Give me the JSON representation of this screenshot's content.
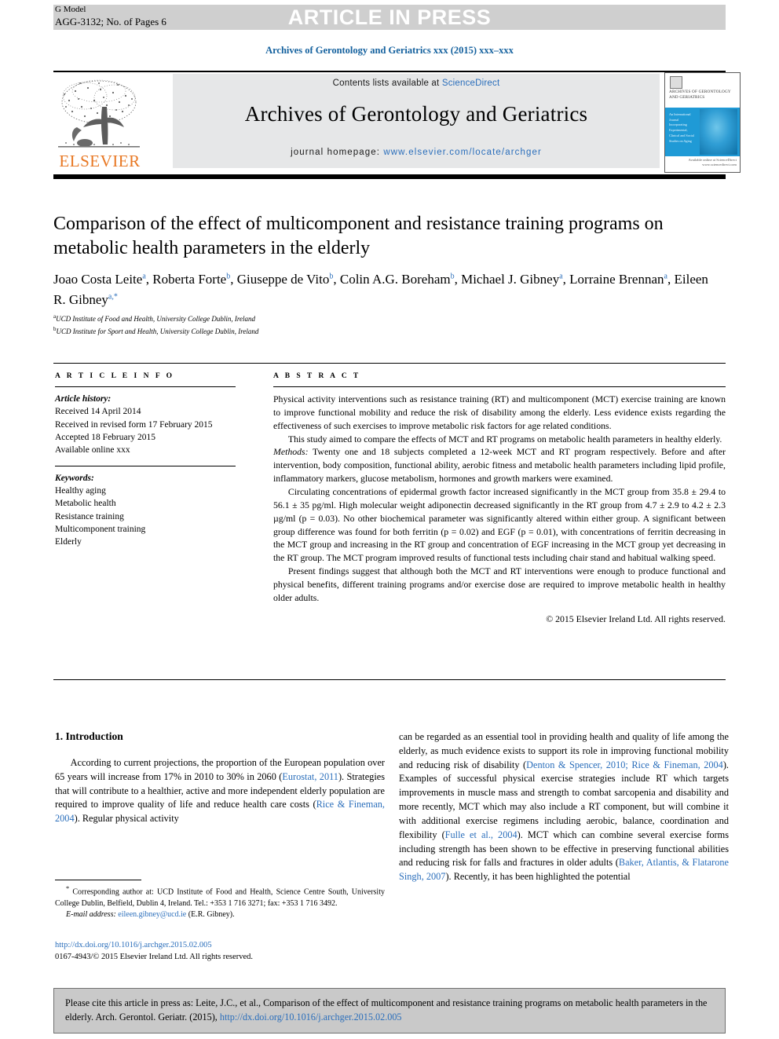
{
  "banner": {
    "gmodel_line1": "G Model",
    "gmodel_line2": "AGG-3132; No. of Pages 6",
    "article_in_press": "ARTICLE IN PRESS"
  },
  "running_head": "Archives of Gerontology and Geriatrics xxx (2015) xxx–xxx",
  "masthead": {
    "contents_prefix": "Contents lists available at ",
    "sciencedirect": "ScienceDirect",
    "journal_title": "Archives of Gerontology and Geriatrics",
    "homepage_prefix": "journal homepage: ",
    "homepage_url": "www.elsevier.com/locate/archger",
    "publisher": "ELSEVIER",
    "cover_title": "ARCHIVES OF GERONTOLOGY AND GERIATRICS",
    "cover_sub": "An International Journal Incorporating Experimental, Clinical and Social Studies on Aging",
    "cover_footer": "Available online at ScienceDirect www.sciencedirect.com"
  },
  "article": {
    "title": "Comparison of the effect of multicomponent and resistance training programs on metabolic health parameters in the elderly",
    "authors_line1": "Joao Costa Leite",
    "authors_line1_sup": "a",
    "authors_html": "Joao Costa Leite<sup>a</sup>, Roberta Forte<sup>b</sup>, Giuseppe de Vito<sup>b</sup>, Colin A.G. Boreham<sup>b</sup>, Michael J. Gibney<sup>a</sup>, Lorraine Brennan<sup>a</sup>, Eileen R. Gibney<sup>a,*</sup>",
    "affiliation_a": "UCD Institute of Food and Health, University College Dublin, Ireland",
    "affiliation_b": "UCD Institute for Sport and Health, University College Dublin, Ireland"
  },
  "article_info": {
    "heading": "A R T I C L E  I N F O",
    "history_label": "Article history:",
    "history": [
      "Received 14 April 2014",
      "Received in revised form 17 February 2015",
      "Accepted 18 February 2015",
      "Available online xxx"
    ],
    "keywords_label": "Keywords:",
    "keywords": [
      "Healthy aging",
      "Metabolic health",
      "Resistance training",
      "Multicomponent training",
      "Elderly"
    ]
  },
  "abstract": {
    "heading": "A B S T R A C T",
    "p1": "Physical activity interventions such as resistance training (RT) and multicomponent (MCT) exercise training are known to improve functional mobility and reduce the risk of disability among the elderly. Less evidence exists regarding the effectiveness of such exercises to improve metabolic risk factors for age related conditions.",
    "p2": "This study aimed to compare the effects of MCT and RT programs on metabolic health parameters in healthy elderly.",
    "p3_label": "Methods:",
    "p3": " Twenty one and 18 subjects completed a 12-week MCT and RT program respectively. Before and after intervention, body composition, functional ability, aerobic fitness and metabolic health parameters including lipid profile, inflammatory markers, glucose metabolism, hormones and growth markers were examined.",
    "p4": "Circulating concentrations of epidermal growth factor increased significantly in the MCT group from 35.8 ± 29.4  to 56.1 ± 35 pg/ml. High molecular weight adiponectin decreased significantly in the RT group from  4.7 ± 2.9  to 4.2 ± 2.3 µg/ml (p = 0.03). No other biochemical parameter was significantly altered within either group. A significant between group difference was found for both ferritin (p = 0.02) and EGF (p = 0.01), with concentrations of ferritin decreasing in the MCT group and increasing in the RT group and concentration of EGF increasing in the MCT group yet decreasing in the RT group. The MCT program improved results of functional tests including chair stand and habitual walking speed.",
    "p5": "Present findings suggest that although both the MCT and RT interventions were enough to produce functional and physical benefits, different training programs and/or exercise dose are required to improve metabolic health in healthy older adults.",
    "copyright": "© 2015 Elsevier Ireland Ltd. All rights reserved."
  },
  "introduction": {
    "heading": "1. Introduction",
    "left_p1_a": "According to current projections, the proportion of the European population over 65 years will increase from 17% in 2010 to 30% in 2060 (",
    "left_ref1": "Eurostat, 2011",
    "left_p1_b": "). Strategies that will contribute to a healthier, active and more independent elderly population are required to improve quality of life and reduce health care costs (",
    "left_ref2": "Rice & Fineman, 2004",
    "left_p1_c": "). Regular physical activity",
    "right_p1_a": "can be regarded as an essential tool in providing health and quality of life among the elderly, as much evidence exists to support its role in improving functional mobility and reducing risk of disability (",
    "right_ref1": "Denton & Spencer, 2010; Rice & Fineman, 2004",
    "right_p1_b": "). Examples of successful physical exercise strategies include RT which targets improvements in muscle mass and strength to combat sarcopenia and disability and more recently, MCT which may also include a RT component, but will combine it with additional exercise regimens including aerobic, balance, coordination and flexibility (",
    "right_ref2": "Fulle et al., 2004",
    "right_p1_c": "). MCT which can combine several exercise forms including strength has been shown to be effective in preserving functional abilities and reducing risk for falls and fractures in older adults (",
    "right_ref3": "Baker, Atlantis, & Flatarone Singh, 2007",
    "right_p1_d": "). Recently, it has been highlighted the potential"
  },
  "footnote": {
    "star": "*",
    "corresponding": " Corresponding author at: UCD Institute of Food and Health, Science Centre South, University College Dublin, Belfield, Dublin 4, Ireland. Tel.: +353 1 716 3271; fax: +353 1 716 3492.",
    "email_label": "E-mail address:",
    "email": "eileen.gibney@ucd.ie",
    "email_suffix": " (E.R. Gibney).",
    "doi": "http://dx.doi.org/10.1016/j.archger.2015.02.005",
    "issn_line": "0167-4943/© 2015 Elsevier Ireland Ltd. All rights reserved."
  },
  "cite_box": {
    "text_a": "Please cite this article in press as: Leite, J.C., et al., Comparison of the effect of multicomponent and resistance training programs on metabolic health parameters in the elderly. Arch. Gerontol. Geriatr. (2015), ",
    "link": "http://dx.doi.org/10.1016/j.archger.2015.02.005"
  },
  "colors": {
    "link_blue": "#2a6ebb",
    "banner_gray": "#cfcfcf",
    "mast_gray": "#e6e7e8",
    "cite_gray": "#c9c9c9",
    "elsevier_orange": "#e87722",
    "cover_blue": "#1f9ad6"
  }
}
